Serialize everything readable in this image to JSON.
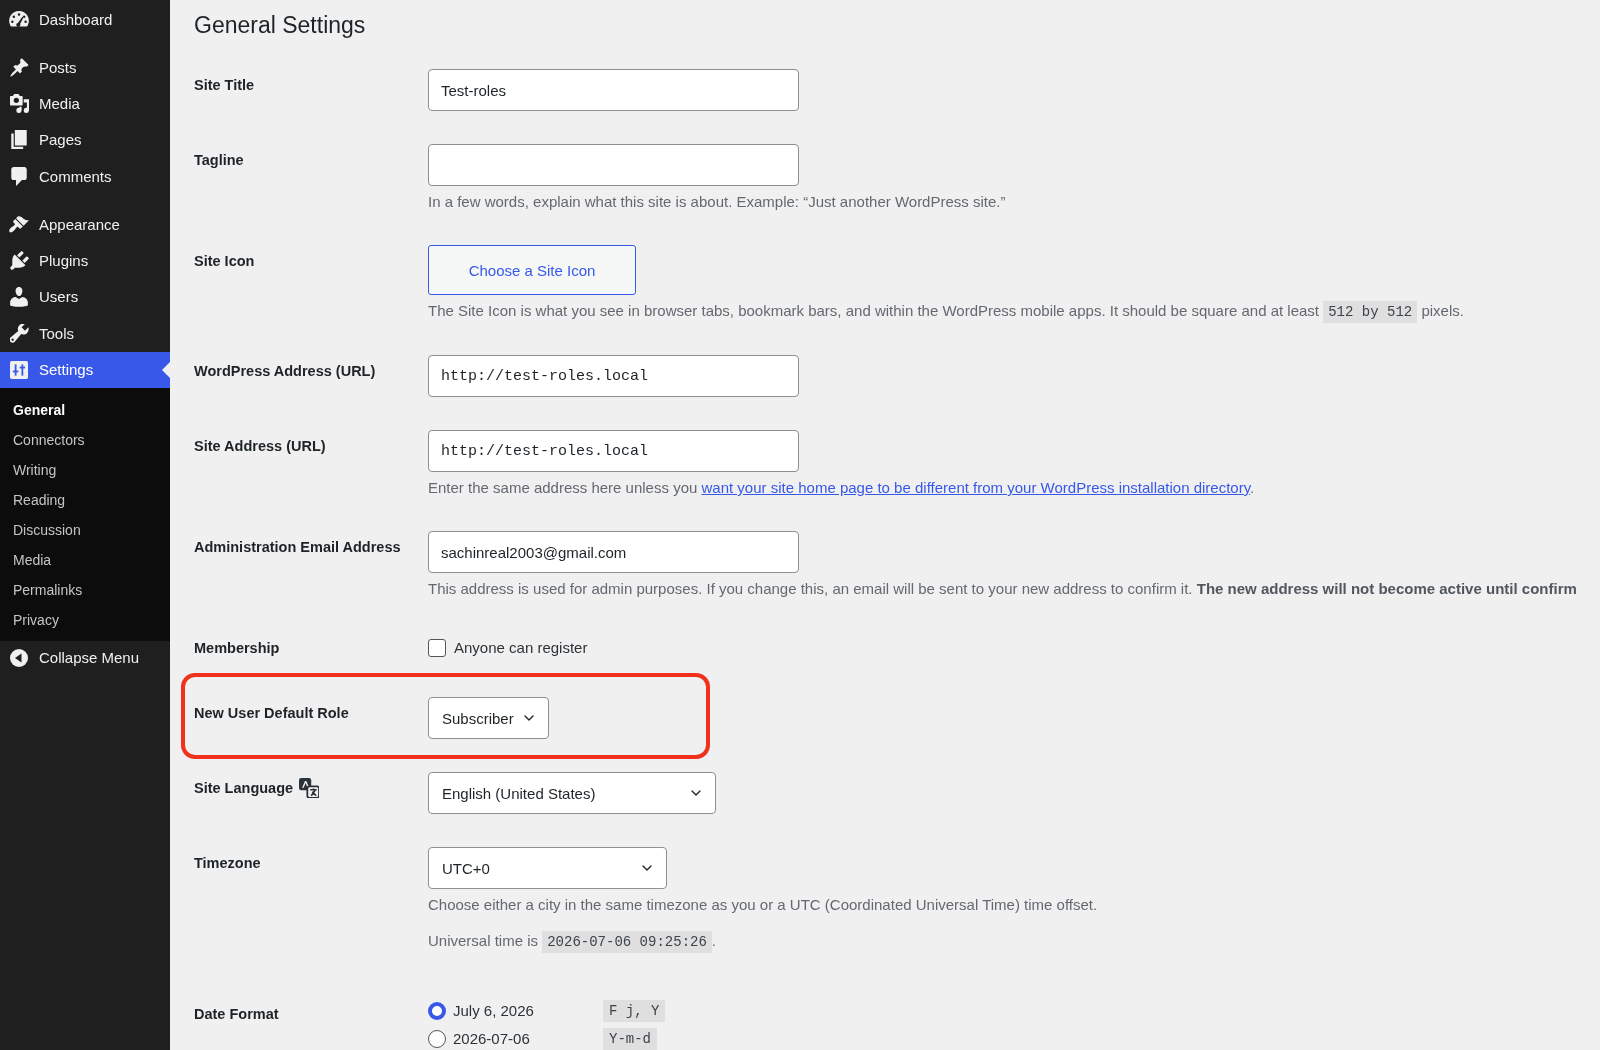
{
  "sidebar": {
    "groups": [
      {
        "items": [
          {
            "label": "Dashboard",
            "selected": false
          }
        ]
      },
      {
        "items": [
          {
            "label": "Posts",
            "selected": false
          },
          {
            "label": "Media",
            "selected": false
          },
          {
            "label": "Pages",
            "selected": false
          },
          {
            "label": "Comments",
            "selected": false
          }
        ]
      },
      {
        "items": [
          {
            "label": "Appearance",
            "selected": false
          },
          {
            "label": "Plugins",
            "selected": false
          },
          {
            "label": "Users",
            "selected": false
          },
          {
            "label": "Tools",
            "selected": false
          },
          {
            "label": "Settings",
            "selected": true,
            "children": [
              {
                "label": "General",
                "selected": true
              },
              {
                "label": "Connectors",
                "selected": false
              },
              {
                "label": "Writing",
                "selected": false
              },
              {
                "label": "Reading",
                "selected": false
              },
              {
                "label": "Discussion",
                "selected": false
              },
              {
                "label": "Media",
                "selected": false
              },
              {
                "label": "Permalinks",
                "selected": false
              },
              {
                "label": "Privacy",
                "selected": false
              }
            ]
          }
        ]
      }
    ],
    "collapse": {
      "label": "Collapse Menu"
    }
  },
  "page_title": "General Settings",
  "fields": [
    {
      "kind": "text",
      "label": "Site Title",
      "value": "Test-roles",
      "highlighted": false
    },
    {
      "kind": "text",
      "label": "Tagline",
      "highlighted": false,
      "notes": [
        [
          {
            "kind": "text",
            "text": "In a few words, explain what this site is about. Example: “Just another WordPress site.”"
          }
        ]
      ]
    },
    {
      "kind": "button",
      "label": "Site Icon",
      "button": "Choose a Site Icon",
      "highlighted": false,
      "notes": [
        [
          {
            "kind": "text",
            "text": "The Site Icon is what you see in browser tabs, bookmark bars, and within the WordPress mobile apps. It should be square and at least "
          },
          {
            "kind": "code",
            "text": "512 by 512"
          },
          {
            "kind": "text",
            "text": " pixels."
          }
        ]
      ]
    },
    {
      "kind": "url",
      "label": "WordPress Address (URL)",
      "value": "http://test-roles.local",
      "highlighted": false
    },
    {
      "kind": "url",
      "label": "Site Address (URL)",
      "value": "http://test-roles.local",
      "highlighted": false,
      "notes": [
        [
          {
            "kind": "text",
            "text": "Enter the same address here unless you "
          },
          {
            "kind": "link",
            "text": "want your site home page to be different from your WordPress installation directory"
          },
          {
            "kind": "text",
            "text": "."
          }
        ]
      ]
    },
    {
      "kind": "text",
      "label": "Administration Email Address",
      "value": "sachinreal2003@gmail.com",
      "highlighted": false,
      "notes": [
        [
          {
            "kind": "text",
            "text": "This address is used for admin purposes. If you change this, an email will be sent to your new address to confirm it. **The new address will not become active until confirm**"
          }
        ]
      ]
    },
    {
      "kind": "checkbox",
      "label": "Membership",
      "option": "Anyone can register",
      "checked": false,
      "highlighted": false
    },
    {
      "kind": "select",
      "label": "New User Default Role",
      "value": "Subscriber",
      "highlighted": true
    },
    {
      "kind": "language",
      "label": "Site Language",
      "value": "English (United States)",
      "highlighted": false
    },
    {
      "kind": "timezone",
      "label": "Timezone",
      "value": "UTC+0",
      "highlighted": false,
      "notes": [
        [
          {
            "kind": "text",
            "text": "Choose either a city in the same timezone as you or a UTC (Coordinated Universal Time) time offset."
          }
        ],
        [
          {
            "kind": "text",
            "text": "Universal time is "
          },
          {
            "kind": "code",
            "text": "2026-07-06 09:25:26"
          },
          {
            "kind": "text",
            "text": "."
          }
        ]
      ]
    },
    {
      "kind": "radio",
      "label": "Date Format",
      "highlighted": false,
      "options": [
        {
          "label": "July 6, 2026",
          "format": "F j, Y",
          "selected": true
        },
        {
          "label": "2026-07-06",
          "format": "Y-m-d",
          "selected": false
        }
      ]
    }
  ]
}
